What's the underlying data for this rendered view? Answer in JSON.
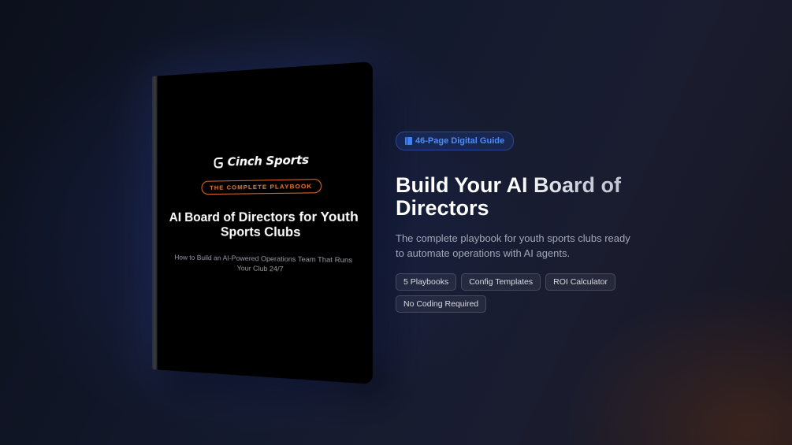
{
  "book": {
    "brand": "Cinch Sports",
    "pill": "THE COMPLETE PLAYBOOK",
    "title": "AI Board of Directors for Youth Sports Clubs",
    "subtitle": "How to Build an AI-Powered Operations Team That Runs Your Club 24/7",
    "icon": "cinch-logo-icon"
  },
  "badge": {
    "icon": "book-icon",
    "label": "46-Page Digital Guide"
  },
  "headline": "Build Your AI Board of Directors",
  "description": "The complete playbook for youth sports clubs ready to automate operations with AI agents.",
  "tags": [
    "5 Playbooks",
    "Config Templates",
    "ROI Calculator",
    "No Coding Required"
  ],
  "colors": {
    "accent_blue": "#4d8cf5",
    "accent_orange": "#e0661f",
    "background": "#141a2e"
  }
}
